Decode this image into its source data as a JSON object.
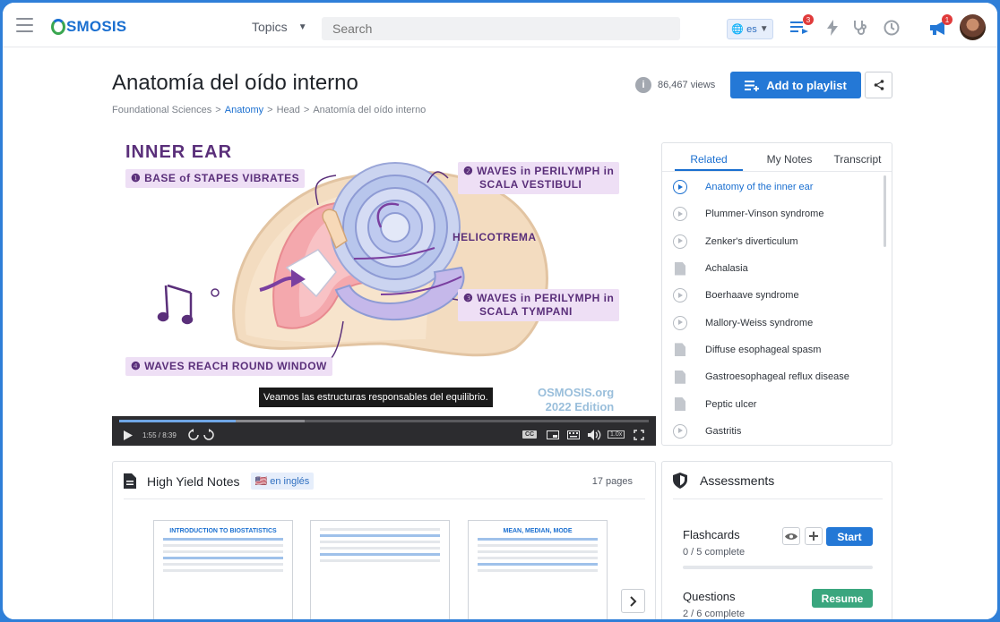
{
  "nav": {
    "topics_label": "Topics",
    "search_placeholder": "Search",
    "language": "es",
    "playlist_badge": "3",
    "notifications_badge": "1"
  },
  "logo": {
    "text": "SMOSIS"
  },
  "header": {
    "title": "Anatomía del oído interno",
    "views": "86,467 views",
    "add_to_playlist": "Add to playlist"
  },
  "breadcrumb": {
    "items": [
      "Foundational Sciences",
      "Anatomy",
      "Head",
      "Anatomía del oído interno"
    ],
    "separator": ">"
  },
  "video": {
    "heading": "INNER EAR",
    "callouts": {
      "step1": "❶ BASE of STAPES VIBRATES",
      "step2_line1": "❷ WAVES in PERILYMPH in",
      "step2_line2": "SCALA VESTIBULI",
      "step3_line1": "❸ WAVES in PERILYMPH in",
      "step3_line2": "SCALA TYMPANI",
      "step4": "❹ WAVES REACH ROUND WINDOW",
      "helicotrema": "HELICOTREMA"
    },
    "subtitle": "Veamos las estructuras responsables del equilibrio.",
    "watermark_line1": "OSMOSIS.org",
    "watermark_line2": "2022 Edition",
    "time": "1:55 / 8:39",
    "progress": 0.22,
    "speed": "1.0x",
    "cc": "CC"
  },
  "sidebar": {
    "tabs": [
      "Related",
      "My Notes",
      "Transcript"
    ],
    "items": [
      {
        "label": "Anatomy of the inner ear",
        "icon": "play-circle-icon",
        "active": true
      },
      {
        "label": "Plummer-Vinson syndrome",
        "icon": "play-circle-icon"
      },
      {
        "label": "Zenker's diverticulum",
        "icon": "play-circle-icon"
      },
      {
        "label": "Achalasia",
        "icon": "document-icon"
      },
      {
        "label": "Boerhaave syndrome",
        "icon": "play-circle-icon"
      },
      {
        "label": "Mallory-Weiss syndrome",
        "icon": "play-circle-icon"
      },
      {
        "label": "Diffuse esophageal spasm",
        "icon": "document-icon"
      },
      {
        "label": "Gastroesophageal reflux disease",
        "icon": "document-icon"
      },
      {
        "label": "Peptic ulcer",
        "icon": "document-icon"
      },
      {
        "label": "Gastritis",
        "icon": "play-circle-icon"
      }
    ]
  },
  "notes": {
    "title": "High Yield Notes",
    "language_tag": "🇺🇸 en inglés",
    "pages": "17 pages",
    "thumbs": [
      {
        "title": "INTRODUCTION TO BIOSTATISTICS"
      },
      {
        "title": ""
      },
      {
        "title": "MEAN, MEDIAN, MODE"
      }
    ]
  },
  "assessments": {
    "title": "Assessments",
    "flashcards": {
      "label": "Flashcards",
      "progress": "0 / 5 complete",
      "action": "Start"
    },
    "questions": {
      "label": "Questions",
      "progress": "2 / 6 complete",
      "action": "Resume"
    }
  },
  "colors": {
    "brand_blue": "#2478d6",
    "brand_green": "#3aa650",
    "callout_purple": "#5a2f7a"
  }
}
